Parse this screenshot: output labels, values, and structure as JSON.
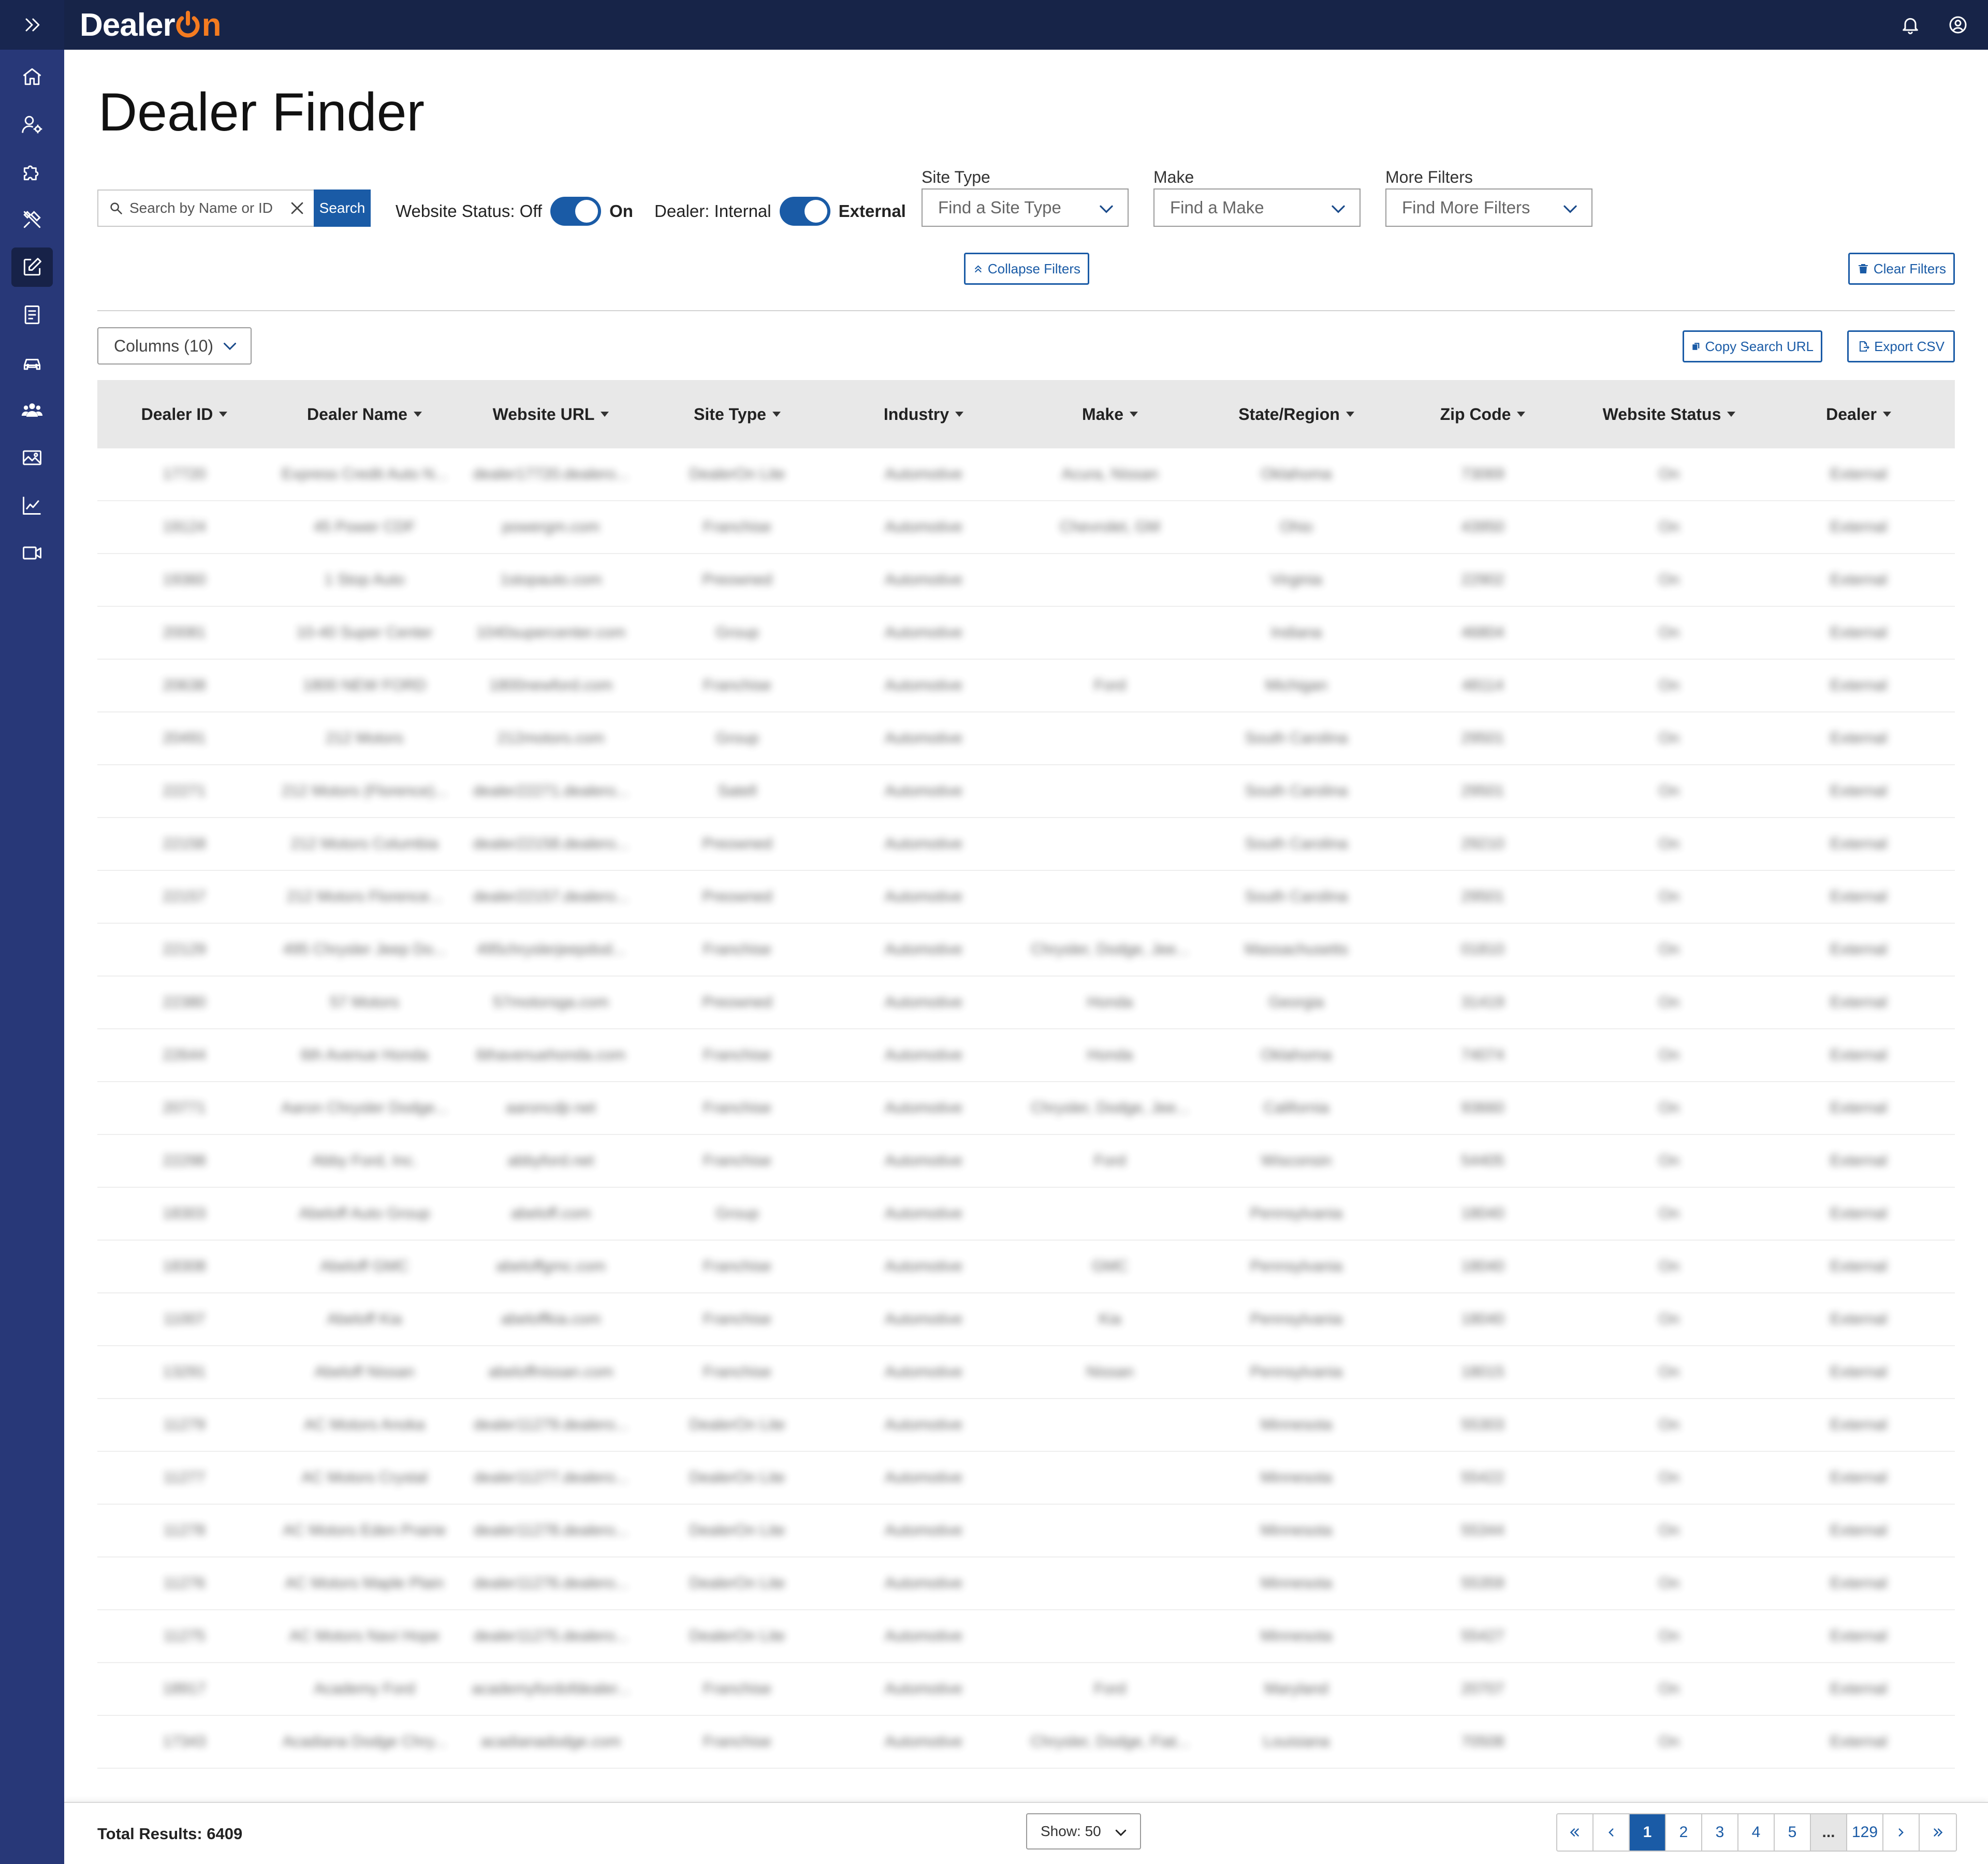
{
  "brand": {
    "name_prefix": "Dealer",
    "name_suffix": "n",
    "accent": "#f47b20",
    "primary": "#1a5ba6",
    "nav_bg": "#172448",
    "sidebar_bg": "#283878"
  },
  "sidebar": {
    "items": [
      {
        "icon": "home-icon"
      },
      {
        "icon": "user-settings-icon"
      },
      {
        "icon": "puzzle-icon"
      },
      {
        "icon": "tools-icon"
      },
      {
        "icon": "edit-icon",
        "active": true
      },
      {
        "icon": "document-icon"
      },
      {
        "icon": "car-icon"
      },
      {
        "icon": "users-icon"
      },
      {
        "icon": "image-icon"
      },
      {
        "icon": "chart-icon"
      },
      {
        "icon": "video-icon"
      }
    ]
  },
  "page": {
    "title": "Dealer Finder"
  },
  "search": {
    "placeholder": "Search by Name or ID",
    "button": "Search"
  },
  "toggles": {
    "website_status": {
      "label": "Website Status: Off",
      "on_label": "On"
    },
    "dealer": {
      "label": "Dealer: Internal",
      "on_label": "External"
    }
  },
  "filters": {
    "site_type": {
      "label": "Site Type",
      "placeholder": "Find a Site Type"
    },
    "make": {
      "label": "Make",
      "placeholder": "Find a Make"
    },
    "more": {
      "label": "More Filters",
      "placeholder": "Find More Filters"
    }
  },
  "actions": {
    "collapse_filters": "Collapse Filters",
    "clear_filters": "Clear Filters",
    "columns": "Columns (10)",
    "copy_search_url": "Copy Search URL",
    "export_csv": "Export CSV"
  },
  "table": {
    "headers": [
      "Dealer ID",
      "Dealer Name",
      "Website URL",
      "Site Type",
      "Industry",
      "Make",
      "State/Region",
      "Zip Code",
      "Website Status",
      "Dealer"
    ],
    "rows": [
      [
        "17720",
        "Express Credit Auto N...",
        "dealer17720.dealero...",
        "DealerOn Lite",
        "Automotive",
        "Acura, Nissan",
        "Oklahoma",
        "73069",
        "On",
        "External"
      ],
      [
        "19124",
        "45 Power CDF",
        "powergm.com",
        "Franchise",
        "Automotive",
        "Chevrolet, GM",
        "Ohio",
        "43950",
        "On",
        "External"
      ],
      [
        "19360",
        "1 Stop Auto",
        "1stopauto.com",
        "Preowned",
        "Automotive",
        "",
        "Virginia",
        "22902",
        "On",
        "External"
      ],
      [
        "20081",
        "10-40 Super Center",
        "1040supercenter.com",
        "Group",
        "Automotive",
        "",
        "Indiana",
        "46804",
        "On",
        "External"
      ],
      [
        "20638",
        "1800 NEW FORD",
        "1800newford.com",
        "Franchise",
        "Automotive",
        "Ford",
        "Michigan",
        "48114",
        "On",
        "External"
      ],
      [
        "20491",
        "212 Motors",
        "212motors.com",
        "Group",
        "Automotive",
        "",
        "South Carolina",
        "29501",
        "On",
        "External"
      ],
      [
        "22271",
        "212 Motors (Florence)...",
        "dealer22271.dealero...",
        "Satell",
        "Automotive",
        "",
        "South Carolina",
        "29501",
        "On",
        "External"
      ],
      [
        "22158",
        "212 Motors Columbia",
        "dealer22158.dealero...",
        "Preowned",
        "Automotive",
        "",
        "South Carolina",
        "29210",
        "On",
        "External"
      ],
      [
        "22157",
        "212 Motors Florence...",
        "dealer22157.dealero...",
        "Preowned",
        "Automotive",
        "",
        "South Carolina",
        "29501",
        "On",
        "External"
      ],
      [
        "22129",
        "495 Chrysler Jeep Do...",
        "495chryslerjeepdod...",
        "Franchise",
        "Automotive",
        "Chrysler, Dodge, Jee...",
        "Massachusetts",
        "01810",
        "On",
        "External"
      ],
      [
        "22380",
        "57 Motors",
        "57motorsga.com",
        "Preowned",
        "Automotive",
        "Honda",
        "Georgia",
        "31419",
        "On",
        "External"
      ],
      [
        "22644",
        "6th Avenue Honda",
        "6thavenuehonda.com",
        "Franchise",
        "Automotive",
        "Honda",
        "Oklahoma",
        "74074",
        "On",
        "External"
      ],
      [
        "20771",
        "Aaron Chrysler Dodge...",
        "aaroncdjr.net",
        "Franchise",
        "Automotive",
        "Chrysler, Dodge, Jee...",
        "California",
        "93660",
        "On",
        "External"
      ],
      [
        "22298",
        "Abby Ford, Inc.",
        "abbyford.net",
        "Franchise",
        "Automotive",
        "Ford",
        "Wisconsin",
        "54405",
        "On",
        "External"
      ],
      [
        "18303",
        "Abeloff Auto Group",
        "abeloff.com",
        "Group",
        "Automotive",
        "",
        "Pennsylvania",
        "18040",
        "On",
        "External"
      ],
      [
        "18308",
        "Abeloff GMC",
        "abeloffgmc.com",
        "Franchise",
        "Automotive",
        "GMC",
        "Pennsylvania",
        "18040",
        "On",
        "External"
      ],
      [
        "11007",
        "Abeloff Kia",
        "abeloffkia.com",
        "Franchise",
        "Automotive",
        "Kia",
        "Pennsylvania",
        "18040",
        "On",
        "External"
      ],
      [
        "13291",
        "Abeloff Nissan",
        "abeloffnissan.com",
        "Franchise",
        "Automotive",
        "Nissan",
        "Pennsylvania",
        "18015",
        "On",
        "External"
      ],
      [
        "11279",
        "AC Motors Anoka",
        "dealer11279.dealero...",
        "DealerOn Lite",
        "Automotive",
        "",
        "Minnesota",
        "55303",
        "On",
        "External"
      ],
      [
        "11277",
        "AC Motors Crystal",
        "dealer11277.dealero...",
        "DealerOn Lite",
        "Automotive",
        "",
        "Minnesota",
        "55422",
        "On",
        "External"
      ],
      [
        "11278",
        "AC Motors Eden Prairie",
        "dealer11278.dealero...",
        "DealerOn Lite",
        "Automotive",
        "",
        "Minnesota",
        "55344",
        "On",
        "External"
      ],
      [
        "11276",
        "AC Motors Maple Plain",
        "dealer11276.dealero...",
        "DealerOn Lite",
        "Automotive",
        "",
        "Minnesota",
        "55359",
        "On",
        "External"
      ],
      [
        "11275",
        "AC Motors Navi Hope",
        "dealer11275.dealero...",
        "DealerOn Lite",
        "Automotive",
        "",
        "Minnesota",
        "55427",
        "On",
        "External"
      ],
      [
        "18917",
        "Academy Ford",
        "academyfordofdealer...",
        "Franchise",
        "Automotive",
        "Ford",
        "Maryland",
        "20707",
        "On",
        "External"
      ],
      [
        "17343",
        "Acadiana Dodge Chry...",
        "acadianadodge.com",
        "Franchise",
        "Automotive",
        "Chrysler, Dodge, Fiat...",
        "Louisiana",
        "70508",
        "On",
        "External"
      ]
    ]
  },
  "footer": {
    "total": "Total Results: 6409",
    "show": "Show: 50",
    "pages": [
      "1",
      "2",
      "3",
      "4",
      "5",
      "...",
      "129"
    ],
    "current_page": "1"
  }
}
